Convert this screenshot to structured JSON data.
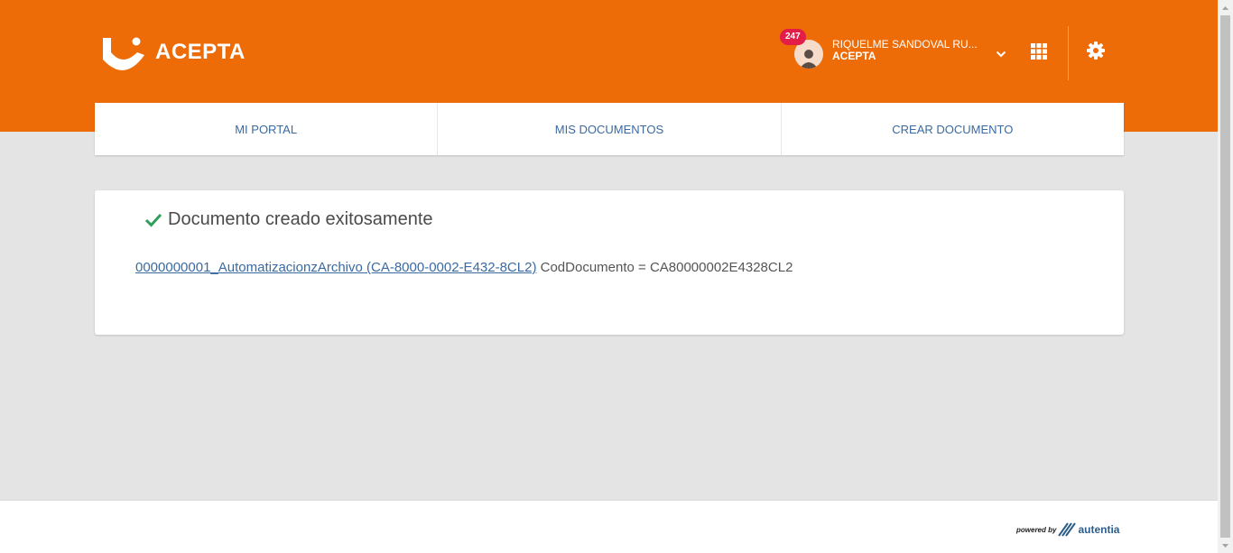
{
  "brand": {
    "name": "ACEPTA",
    "color": "#ee6c08"
  },
  "user": {
    "name": "RIQUELME SANDOVAL RU...",
    "org": "ACEPTA",
    "notifications": "247"
  },
  "nav": {
    "tabs": [
      {
        "label": "MI PORTAL"
      },
      {
        "label": "MIS DOCUMENTOS"
      },
      {
        "label": "CREAR DOCUMENTO"
      }
    ]
  },
  "result": {
    "message": "Documento creado exitosamente",
    "doc_link": "0000000001_AutomatizacionzArchivo (CA-8000-0002-E432-8CL2)",
    "doc_code": "CodDocumento = CA80000002E4328CL2"
  },
  "footer": {
    "powered_by": "powered by",
    "vendor": "autentia"
  },
  "icons": {
    "logo": "acepta-smile-logo",
    "avatar": "user-avatar-icon",
    "chevron": "chevron-down-icon",
    "apps": "apps-grid-icon",
    "settings": "gear-icon",
    "success": "check-icon"
  }
}
